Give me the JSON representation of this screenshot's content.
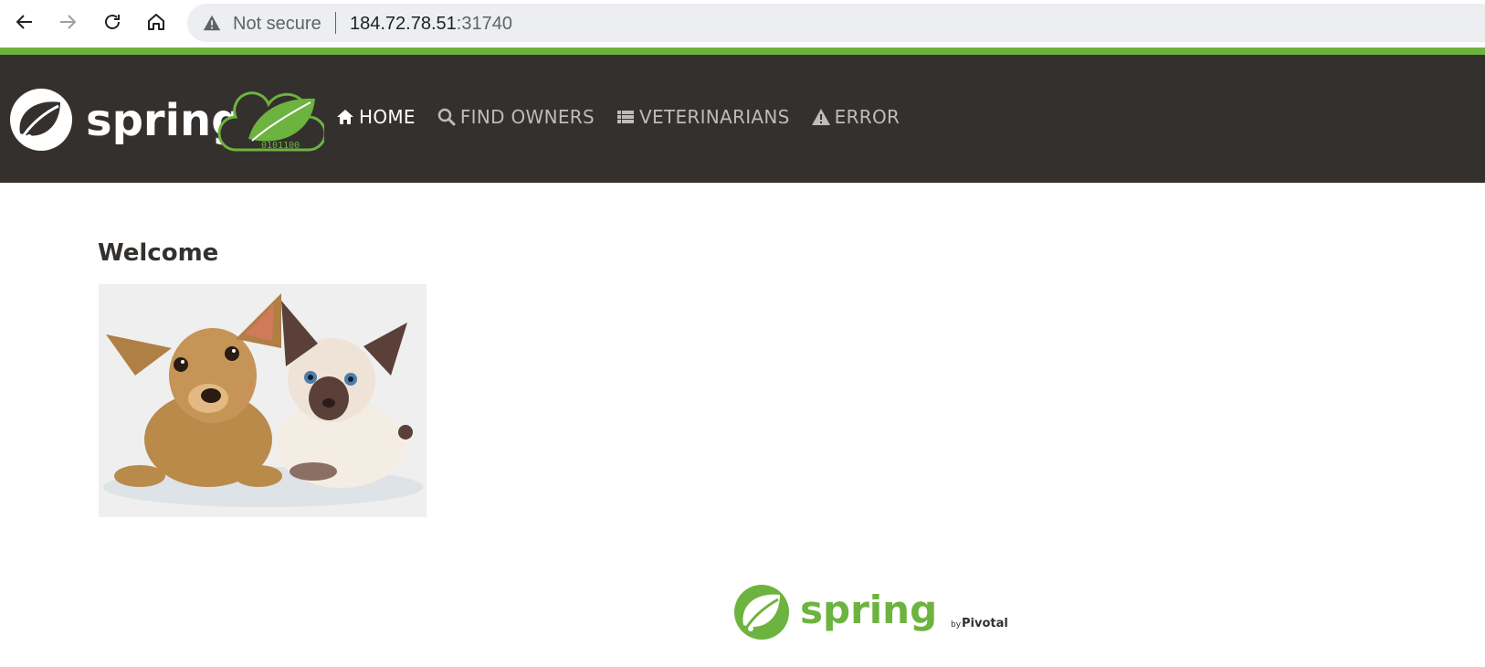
{
  "browser": {
    "back_icon": "arrow-left-icon",
    "forward_icon": "arrow-right-icon",
    "reload_icon": "reload-icon",
    "home_icon": "home-icon",
    "security_text": "Not secure",
    "url_host": "184.72.78.51",
    "url_port": ":31740"
  },
  "navbar": {
    "logo_text": "spring",
    "logo_cloud_digits": "0101100",
    "items": [
      {
        "label": "HOME",
        "icon": "home-icon",
        "active": true
      },
      {
        "label": "FIND OWNERS",
        "icon": "search-icon",
        "active": false
      },
      {
        "label": "VETERINARIANS",
        "icon": "list-icon",
        "active": false
      },
      {
        "label": "ERROR",
        "icon": "warning-icon",
        "active": false
      }
    ]
  },
  "main": {
    "heading": "Welcome",
    "image": "pets-image"
  },
  "footer": {
    "logo_text": "spring",
    "by_text": "by",
    "vendor_text": "Pivotal."
  },
  "colors": {
    "navbar_bg": "#34302d",
    "spring_green": "#6db33f",
    "menu_active": "#ffffff",
    "menu_inactive": "#bcbcbc"
  }
}
